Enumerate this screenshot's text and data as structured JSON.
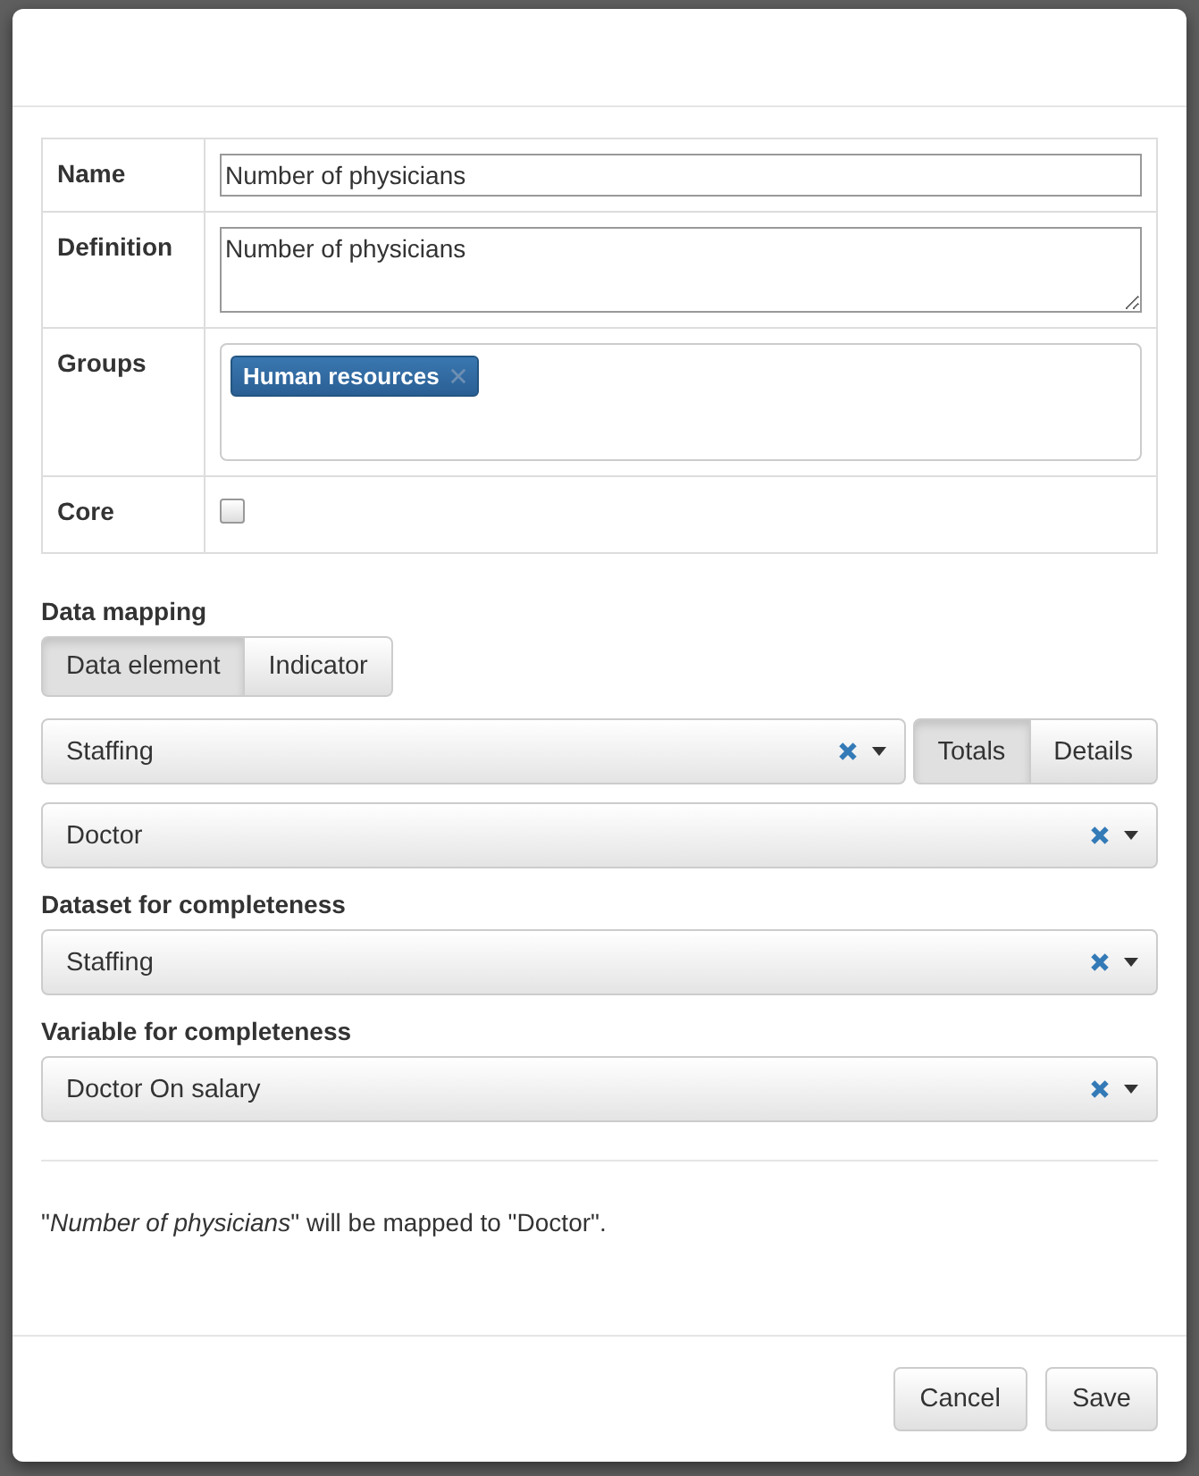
{
  "fields": [
    {
      "kind": "text",
      "label": "Name",
      "value": "Number of physicians"
    },
    {
      "kind": "textarea",
      "label": "Definition",
      "value": "Number of physicians"
    },
    {
      "kind": "tags",
      "label": "Groups",
      "tags": [
        "Human resources"
      ]
    },
    {
      "kind": "checkbox",
      "label": "Core",
      "checked": false
    }
  ],
  "data_mapping": {
    "label": "Data mapping",
    "source_types": [
      {
        "label": "Data element",
        "selected": true
      },
      {
        "label": "Indicator",
        "selected": false
      }
    ],
    "group_select": {
      "value": "Staffing"
    },
    "aggregation": [
      {
        "label": "Totals",
        "selected": true
      },
      {
        "label": "Details",
        "selected": false
      }
    ],
    "element_select": {
      "value": "Doctor"
    }
  },
  "completeness": [
    {
      "label": "Dataset for completeness",
      "value": "Staffing"
    },
    {
      "label": "Variable for completeness",
      "value": "Doctor On salary"
    }
  ],
  "summary": "\"*Number of physicians*\" will be mapped to \"Doctor\".",
  "buttons": [
    "Cancel",
    "Save"
  ]
}
